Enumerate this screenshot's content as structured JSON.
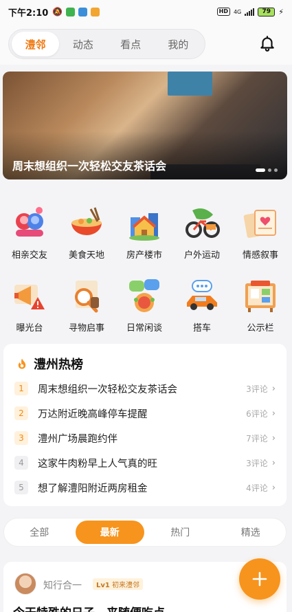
{
  "status_bar": {
    "time": "下午2:10",
    "net": "4G",
    "battery": "79"
  },
  "top_tabs": [
    {
      "label": "澧邻",
      "active": true
    },
    {
      "label": "动态",
      "active": false
    },
    {
      "label": "看点",
      "active": false
    },
    {
      "label": "我的",
      "active": false
    }
  ],
  "banner": {
    "title": "周末想组织一次轻松交友茶话会",
    "page_index": 1,
    "page_count": 3
  },
  "categories": [
    {
      "label": "相亲交友",
      "icon": "dating-icon"
    },
    {
      "label": "美食天地",
      "icon": "food-bowl-icon"
    },
    {
      "label": "房产楼市",
      "icon": "house-icon"
    },
    {
      "label": "户外运动",
      "icon": "bicycle-icon"
    },
    {
      "label": "情感叙事",
      "icon": "letter-heart-icon"
    },
    {
      "label": "曝光台",
      "icon": "megaphone-warning-icon"
    },
    {
      "label": "寻物启事",
      "icon": "magnifier-icon"
    },
    {
      "label": "日常闲谈",
      "icon": "chat-bubbles-icon"
    },
    {
      "label": "搭车",
      "icon": "car-icon"
    },
    {
      "label": "公示栏",
      "icon": "bulletin-board-icon"
    }
  ],
  "hot_list": {
    "title": "澧州热榜",
    "items": [
      {
        "rank": "1",
        "text": "周末想组织一次轻松交友茶话会",
        "comments": "3评论"
      },
      {
        "rank": "2",
        "text": "万达附近晚高峰停车提醒",
        "comments": "6评论"
      },
      {
        "rank": "3",
        "text": "澧州广场晨跑约伴",
        "comments": "7评论"
      },
      {
        "rank": "4",
        "text": "这家牛肉粉早上人气真的旺",
        "comments": "3评论"
      },
      {
        "rank": "5",
        "text": "想了解澧阳附近两房租金",
        "comments": "4评论"
      }
    ]
  },
  "filters": [
    {
      "label": "全部",
      "active": false
    },
    {
      "label": "最新",
      "active": true
    },
    {
      "label": "热门",
      "active": false
    },
    {
      "label": "精选",
      "active": false
    }
  ],
  "post": {
    "username": "知行合一",
    "level": "Lv1",
    "level_title": "初来澧邻",
    "title": "今天特殊的日子，来随便吃点"
  },
  "colors": {
    "accent": "#f7941d",
    "active_tab_text": "#f07a13"
  }
}
